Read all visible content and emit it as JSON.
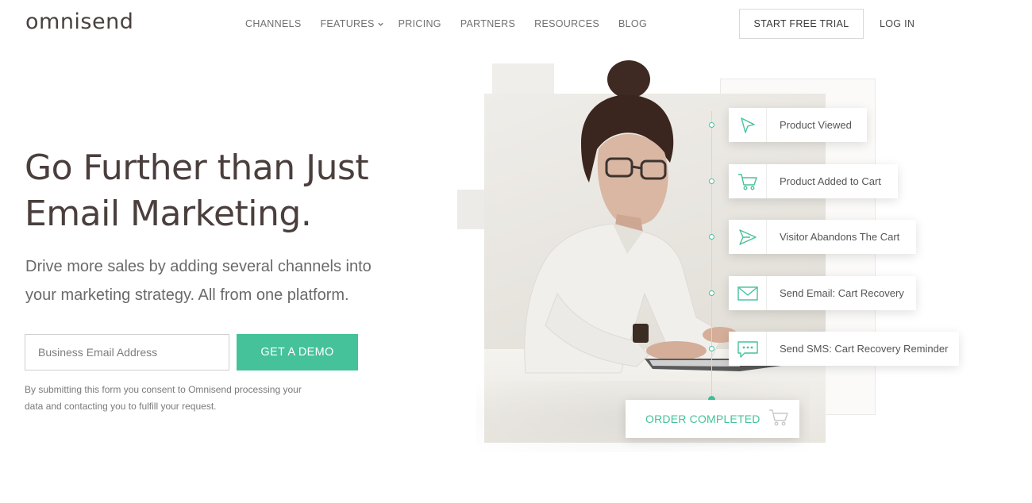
{
  "brand": {
    "logo_text": "omnisend",
    "accent_color": "#45c29a"
  },
  "nav": {
    "items": [
      {
        "label": "CHANNELS",
        "has_dropdown": false
      },
      {
        "label": "FEATURES",
        "has_dropdown": true
      },
      {
        "label": "PRICING",
        "has_dropdown": false
      },
      {
        "label": "PARTNERS",
        "has_dropdown": false
      },
      {
        "label": "RESOURCES",
        "has_dropdown": false
      },
      {
        "label": "BLOG",
        "has_dropdown": false
      }
    ],
    "trial_label": "START FREE TRIAL",
    "login_label": "LOG IN"
  },
  "hero": {
    "headline_line1": "Go Further than Just",
    "headline_line2": "Email Marketing.",
    "subline": "Drive more sales by adding several channels into your marketing strategy. All from one platform.",
    "email_placeholder": "Business Email Address",
    "demo_label": "GET A DEMO",
    "consent": "By submitting this form you consent to Omnisend processing your data and contacting you to fulfill your request."
  },
  "workflow": {
    "steps": [
      {
        "label": "Product Viewed",
        "icon": "cursor-icon"
      },
      {
        "label": "Product Added to Cart",
        "icon": "cart-icon"
      },
      {
        "label": "Visitor Abandons The Cart",
        "icon": "paper-plane-icon"
      },
      {
        "label": "Send Email: Cart Recovery",
        "icon": "envelope-icon"
      },
      {
        "label": "Send SMS: Cart Recovery Reminder",
        "icon": "chat-bubble-icon"
      }
    ],
    "final_label": "ORDER COMPLETED",
    "final_icon": "cart-icon"
  }
}
